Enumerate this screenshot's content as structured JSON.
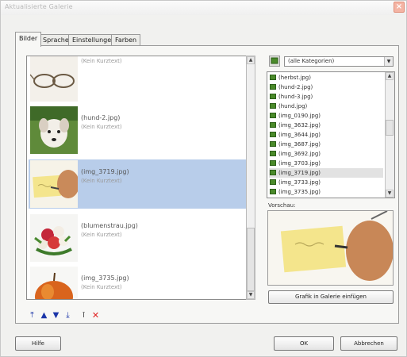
{
  "window": {
    "title": "Aktualisierte Galerie"
  },
  "tabs": [
    {
      "label": "Bilder"
    },
    {
      "label": "Sprache"
    },
    {
      "label": "Einstellungen"
    },
    {
      "label": "Farben"
    }
  ],
  "images": [
    {
      "name": "",
      "description": "(Kein Kurztext)",
      "selected": false
    },
    {
      "name": "(hund-2.jpg)",
      "description": "(Kein Kurztext)",
      "selected": false
    },
    {
      "name": "(img_3719.jpg)",
      "description": "(Kein Kurztext)",
      "selected": true
    },
    {
      "name": "(blumenstrau.jpg)",
      "description": "(Kein Kurztext)",
      "selected": false
    },
    {
      "name": "(img_3735.jpg)",
      "description": "(Kein Kurztext)",
      "selected": false
    }
  ],
  "toolbar_icons": [
    "move-to-top-icon",
    "move-up-icon",
    "move-down-icon",
    "move-to-bottom-icon",
    "text-icon",
    "delete-icon"
  ],
  "category": {
    "selected": "(alle Kategorien)"
  },
  "files": [
    "(herbst.jpg)",
    "(hund-2.jpg)",
    "(hund-3.jpg)",
    "(hund.jpg)",
    "(img_0190.jpg)",
    "(img_3632.jpg)",
    "(img_3644.jpg)",
    "(img_3687.jpg)",
    "(img_3692.jpg)",
    "(img_3703.jpg)",
    "(img_3719.jpg)",
    "(img_3733.jpg)",
    "(img_3735.jpg)"
  ],
  "selected_file": "(img_3719.jpg)",
  "preview": {
    "label": "Vorschau:"
  },
  "buttons": {
    "insert": "Grafik in Galerie einfügen",
    "help": "Hilfe",
    "ok": "OK",
    "cancel": "Abbrechen"
  },
  "colors": {
    "selection": "#b8cdea",
    "accent_icon": "#1b35a8",
    "delete": "#e02020"
  }
}
